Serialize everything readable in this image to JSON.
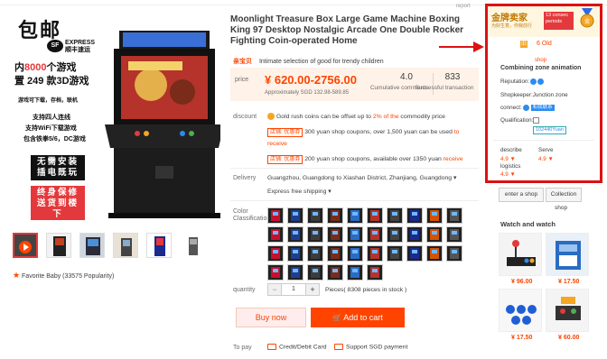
{
  "gallery": {
    "ad": {
      "headline": "包邮",
      "sf_logo": "SF",
      "sf_text_1": "EXPRESS",
      "sf_text_2": "顺丰速运",
      "line1_prefix": "内",
      "line1_red": "8000",
      "line1_suffix": "个游戏",
      "line2": "置 249 款3D游戏",
      "line3": "游戏可下载，存档，联机",
      "line4": "支持四人连线",
      "line5": "支持WiFi下载游戏",
      "line6": "包含铁拳5/6，DC游戏",
      "box_black": "无需安装\n插电既玩",
      "box_red": "终身保修\n送货到楼下"
    },
    "thumbs_count": 7,
    "favorite": "Favorite Baby (33575 Popularity)"
  },
  "product": {
    "report": "report",
    "title": "Moonlight Treasure Box Large Game Machine Boxing King 97 Desktop Nostalgic Arcade One Double Rocker Fighting Coin-operated Home",
    "subtitle_tag": "亲宝贝",
    "subtitle": "Intimate selection of good for trendy children",
    "price_label": "price",
    "price": "¥ 620.00-2756.00",
    "price_sgd": "Approximately SGD 132.98-589.85",
    "stat1_num": "4.0",
    "stat1_label": "Cumulative comments",
    "stat2_num": "833",
    "stat2_label": "Successful transaction",
    "discount_label": "discount",
    "discount_coin_pre": "Gold rush coins can be offset up to ",
    "discount_coin_red": "2% of the",
    "discount_coin_post": " commodity price",
    "coupon1_tag": "店铺: 优惠券",
    "coupon1_text": "300 yuan shop coupons, over 1,500 yuan can be used",
    "coupon1_link": "to",
    "coupon1_link2": "receive",
    "coupon2_tag": "店铺: 优惠券",
    "coupon2_text": "200 yuan shop coupons, available over 1350 yuan",
    "coupon2_link": "receive",
    "delivery_label": "Delivery",
    "delivery_route": "Guangzhou, Guangdong to Xiashan District, Zhanjiang, Guangdong",
    "delivery_free": "Express free shipping",
    "color_label": "Color Classification",
    "quantity_label": "quantity",
    "quantity_value": "1",
    "quantity_minus": "−",
    "quantity_plus": "+",
    "stock": "Pieces( 8308 pieces in stock )",
    "buy_now": "Buy now",
    "add_to_cart": "Add to cart",
    "to_pay_label": "To pay",
    "pay1": "Credit/Debit Card",
    "pay2": "Support SGD payment"
  },
  "shop": {
    "gold_title": "金牌卖家",
    "gold_sub": "为好生意，你我前行",
    "badge_13": "13 consec",
    "badge_13b": "periods",
    "old_icon": "旧",
    "old_text": "6 Old",
    "shop_word": "shop",
    "name": "Combining zone animation",
    "reputation_label": "Reputation:",
    "shopkeeper_label": "Shopkeeper:",
    "shopkeeper_value": "Junction zone",
    "connect_label": "connect:",
    "connect_tag": "和我联系",
    "qualification_label": "Qualification:",
    "qq": "102440Yuan",
    "describe_label": "describe",
    "describe_value": "4.9 ▼",
    "serve_label": "Serve",
    "serve_value": "4.9 ▼",
    "logistics_label": "logistics",
    "logistics_value": "4.9 ▼",
    "enter_shop": "enter a shop",
    "collection": "Collection",
    "collection_sub": "shop"
  },
  "watch": {
    "title": "Watch and watch",
    "items": [
      {
        "price": "¥ 96.00"
      },
      {
        "price": "¥ 17.50"
      },
      {
        "price": "¥ 17.50"
      },
      {
        "price": "¥ 60.00"
      }
    ]
  },
  "colors": {
    "accent": "#ff4400",
    "highlight_border": "#dd1111"
  }
}
